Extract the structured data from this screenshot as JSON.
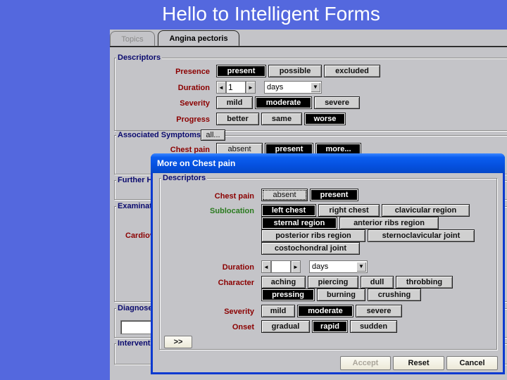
{
  "slide": {
    "title": "Hello to Intelligent Forms",
    "background_color": "#5468de"
  },
  "tabs": [
    {
      "label": "Topics",
      "active": false
    },
    {
      "label": "Angina pectoris",
      "active": true
    }
  ],
  "main": {
    "descriptors": {
      "title": "Descriptors",
      "presence": {
        "label": "Presence",
        "options": [
          "present",
          "possible",
          "excluded"
        ],
        "selected": "present"
      },
      "duration": {
        "label": "Duration",
        "value": "1",
        "unit": "days",
        "left_arrow": "◄",
        "right_arrow": "►",
        "dropdown_arrow": "▼"
      },
      "severity": {
        "label": "Severity",
        "options": [
          "mild",
          "moderate",
          "severe"
        ],
        "selected": "moderate"
      },
      "progress": {
        "label": "Progress",
        "options": [
          "better",
          "same",
          "worse"
        ],
        "selected": "worse"
      }
    },
    "associated_symptoms": {
      "title": "Associated Symptoms",
      "all_button": "all...",
      "chest_pain": {
        "label": "Chest pain",
        "options": [
          "absent",
          "present",
          "more..."
        ],
        "selected": [
          "present",
          "more..."
        ]
      }
    },
    "further_history": {
      "title": "Further H"
    },
    "examination": {
      "title": "Examinati",
      "cardio_label": "Cardiov"
    },
    "diagnoses": {
      "title": "Diagnose",
      "value": ""
    },
    "interventions": {
      "title": "Interventi"
    }
  },
  "dialog": {
    "title": "More on Chest pain",
    "group_title": "Descriptors",
    "chest_pain": {
      "label": "Chest pain",
      "options": [
        "absent",
        "present"
      ],
      "selected": "present",
      "focused": "absent"
    },
    "sublocation": {
      "label": "Sublocation",
      "options": [
        "left chest",
        "right chest",
        "clavicular region",
        "sternal region",
        "anterior ribs region",
        "posterior ribs region",
        "sternoclavicular joint",
        "costochondral joint"
      ],
      "selected": [
        "left chest",
        "sternal region"
      ]
    },
    "duration": {
      "label": "Duration",
      "value": "",
      "unit": "days",
      "left_arrow": "◄",
      "right_arrow": "►",
      "dropdown_arrow": "▼"
    },
    "character": {
      "label": "Character",
      "options": [
        "aching",
        "piercing",
        "dull",
        "throbbing",
        "pressing",
        "burning",
        "crushing"
      ],
      "selected": [
        "pressing"
      ]
    },
    "severity": {
      "label": "Severity",
      "options": [
        "mild",
        "moderate",
        "severe"
      ],
      "selected": "moderate"
    },
    "onset": {
      "label": "Onset",
      "options": [
        "gradual",
        "rapid",
        "sudden"
      ],
      "selected": "rapid"
    },
    "more_button": ">>",
    "buttons": {
      "accept": "Accept",
      "reset": "Reset",
      "cancel": "Cancel"
    }
  }
}
